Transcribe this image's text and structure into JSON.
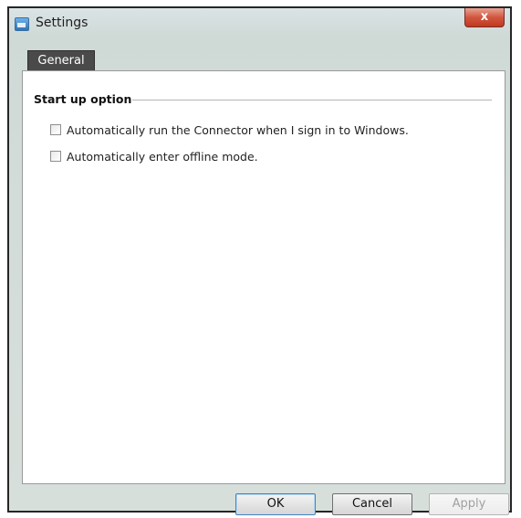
{
  "window": {
    "title": "Settings",
    "close_glyph": "x"
  },
  "tabs": [
    {
      "label": "General",
      "selected": true
    }
  ],
  "group": {
    "title": "Start up option",
    "options": [
      {
        "label": "Automatically run the Connector when I sign in to Windows.",
        "checked": false
      },
      {
        "label": "Automatically enter offline mode.",
        "checked": false
      }
    ]
  },
  "buttons": {
    "ok": "OK",
    "cancel": "Cancel",
    "apply": "Apply",
    "apply_enabled": false
  },
  "icons": {
    "title_icon": "settings-window-icon",
    "close_icon": "close-icon"
  },
  "colors": {
    "tab_background": "#4a4a4a",
    "close_button": "#c8452c"
  }
}
